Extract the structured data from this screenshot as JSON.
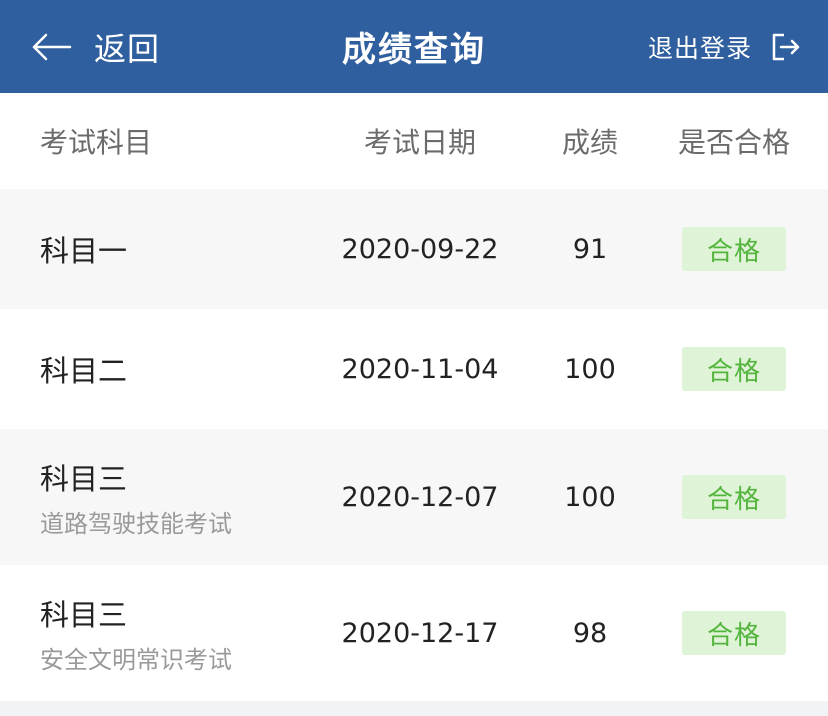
{
  "header": {
    "back_label": "返回",
    "title": "成绩查询",
    "logout_label": "退出登录"
  },
  "table": {
    "columns": [
      "考试科目",
      "考试日期",
      "成绩",
      "是否合格"
    ],
    "rows": [
      {
        "subject": "科目一",
        "subtitle": "",
        "date": "2020-09-22",
        "score": "91",
        "status": "合格"
      },
      {
        "subject": "科目二",
        "subtitle": "",
        "date": "2020-11-04",
        "score": "100",
        "status": "合格"
      },
      {
        "subject": "科目三",
        "subtitle": "道路驾驶技能考试",
        "date": "2020-12-07",
        "score": "100",
        "status": "合格"
      },
      {
        "subject": "科目三",
        "subtitle": "安全文明常识考试",
        "date": "2020-12-17",
        "score": "98",
        "status": "合格"
      }
    ]
  },
  "icons": {
    "back": "arrow-left-icon",
    "logout": "logout-icon"
  },
  "colors": {
    "header_bg": "#2f5f9e",
    "badge_bg": "#dff3d7",
    "badge_text": "#53b53e"
  }
}
